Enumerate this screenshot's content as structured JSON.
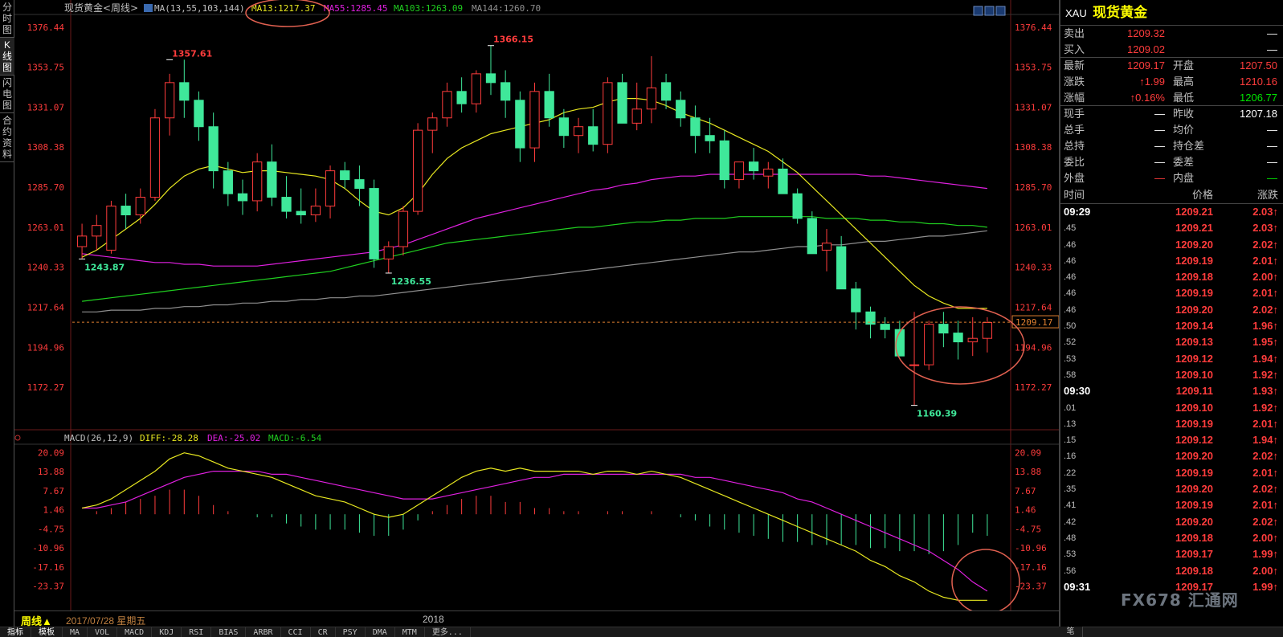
{
  "left_tabs": [
    {
      "label": [
        "分",
        "时",
        "图"
      ],
      "active": false
    },
    {
      "label": [
        "K",
        "线",
        "图"
      ],
      "active": true
    },
    {
      "label": [
        "闪",
        "电",
        "图"
      ],
      "active": false
    },
    {
      "label": [
        "合",
        "约",
        "资",
        "料"
      ],
      "active": false
    }
  ],
  "header": {
    "instrument": "现货黄金<周线>",
    "ma_params": "MA(13,55,103,144)",
    "ma13": "MA13:1217.37",
    "ma55": "MA55:1285.45",
    "ma103": "MA103:1263.09",
    "ma144": "MA144:1260.70"
  },
  "colors": {
    "up": "#ff3c3c",
    "down": "#3fe89a",
    "ma13": "#e8e820",
    "ma55": "#e020e0",
    "ma103": "#20d020",
    "ma144": "#909090",
    "axis_red": "#ff3c3c",
    "circle": "#e06050"
  },
  "price_axis": {
    "labels": [
      "1376.44",
      "1353.75",
      "1331.07",
      "1308.38",
      "1285.70",
      "1263.01",
      "1240.33",
      "1217.64",
      "1194.96",
      "1172.27"
    ],
    "current": "1209.17",
    "current_value": 1209.17
  },
  "annotations": {
    "high1": "1357.61",
    "high2": "1366.15",
    "low1": "1243.87",
    "low2": "1236.55",
    "low3": "1160.39"
  },
  "macd_header": {
    "params": "MACD(26,12,9)",
    "diff": "DIFF:-28.28",
    "dea": "DEA:-25.02",
    "macd": "MACD:-6.54"
  },
  "macd_axis": {
    "labels": [
      "20.09",
      "13.88",
      "7.67",
      "1.46",
      "-4.75",
      "-10.96",
      "-17.16",
      "-23.37"
    ]
  },
  "bottom": {
    "period": "周线▲",
    "date": "2017/07/28 星期五",
    "year_label": "2018"
  },
  "tool_tabs": [
    "指标",
    "模板",
    "MA",
    "VOL",
    "MACD",
    "KDJ",
    "RSI",
    "BIAS",
    "ARBR",
    "CCI",
    "CR",
    "PSY",
    "DMA",
    "MTM",
    "更多..."
  ],
  "right_panel": {
    "code": "XAU",
    "name": "现货黄金",
    "rows": [
      {
        "l1": "卖出",
        "v1": "1209.32",
        "c1": "red",
        "l2": "",
        "v2": "—",
        "c2": "wht"
      },
      {
        "l1": "买入",
        "v1": "1209.02",
        "c1": "red",
        "l2": "",
        "v2": "—",
        "c2": "wht"
      },
      {
        "l1": "最新",
        "v1": "1209.17",
        "c1": "red",
        "l2": "开盘",
        "v2": "1207.50",
        "c2": "red"
      },
      {
        "l1": "涨跌",
        "v1": "↑1.99",
        "c1": "red",
        "l2": "最高",
        "v2": "1210.16",
        "c2": "red"
      },
      {
        "l1": "涨幅",
        "v1": "↑0.16%",
        "c1": "red",
        "l2": "最低",
        "v2": "1206.77",
        "c2": "grn"
      },
      {
        "l1": "现手",
        "v1": "—",
        "c1": "wht",
        "l2": "昨收",
        "v2": "1207.18",
        "c2": "wht"
      },
      {
        "l1": "总手",
        "v1": "—",
        "c1": "wht",
        "l2": "均价",
        "v2": "—",
        "c2": "wht"
      },
      {
        "l1": "总持",
        "v1": "—",
        "c1": "wht",
        "l2": "持仓差",
        "v2": "—",
        "c2": "wht"
      },
      {
        "l1": "委比",
        "v1": "—",
        "c1": "wht",
        "l2": "委差",
        "v2": "—",
        "c2": "wht"
      },
      {
        "l1": "外盘",
        "v1": "—",
        "c1": "red",
        "l2": "内盘",
        "v2": "—",
        "c2": "grn"
      }
    ],
    "ticks_header": [
      "时间",
      "价格",
      "涨跌"
    ],
    "ticks": [
      {
        "t": "09:29",
        "p": "1209.21",
        "c": "2.03↑"
      },
      {
        "t": ".45",
        "p": "1209.21",
        "c": "2.03↑"
      },
      {
        "t": ".46",
        "p": "1209.20",
        "c": "2.02↑"
      },
      {
        "t": ".46",
        "p": "1209.19",
        "c": "2.01↑"
      },
      {
        "t": ".46",
        "p": "1209.18",
        "c": "2.00↑"
      },
      {
        "t": ".46",
        "p": "1209.19",
        "c": "2.01↑"
      },
      {
        "t": ".46",
        "p": "1209.20",
        "c": "2.02↑"
      },
      {
        "t": ".50",
        "p": "1209.14",
        "c": "1.96↑"
      },
      {
        "t": ".52",
        "p": "1209.13",
        "c": "1.95↑"
      },
      {
        "t": ".53",
        "p": "1209.12",
        "c": "1.94↑"
      },
      {
        "t": ".58",
        "p": "1209.10",
        "c": "1.92↑"
      },
      {
        "t": "09:30",
        "p": "1209.11",
        "c": "1.93↑"
      },
      {
        "t": ".01",
        "p": "1209.10",
        "c": "1.92↑"
      },
      {
        "t": ".13",
        "p": "1209.19",
        "c": "2.01↑"
      },
      {
        "t": ".15",
        "p": "1209.12",
        "c": "1.94↑"
      },
      {
        "t": ".16",
        "p": "1209.20",
        "c": "2.02↑"
      },
      {
        "t": ".22",
        "p": "1209.19",
        "c": "2.01↑"
      },
      {
        "t": ".35",
        "p": "1209.20",
        "c": "2.02↑"
      },
      {
        "t": ".41",
        "p": "1209.19",
        "c": "2.01↑"
      },
      {
        "t": ".42",
        "p": "1209.20",
        "c": "2.02↑"
      },
      {
        "t": ".48",
        "p": "1209.18",
        "c": "2.00↑"
      },
      {
        "t": ".53",
        "p": "1209.17",
        "c": "1.99↑"
      },
      {
        "t": ".56",
        "p": "1209.18",
        "c": "2.00↑"
      },
      {
        "t": "09:31",
        "p": "1209.17",
        "c": "1.99↑"
      }
    ],
    "stroke_label": "笔"
  },
  "chart_data": {
    "type": "candlestick",
    "price_range": [
      1155,
      1380
    ],
    "macd_range": [
      -30,
      22
    ],
    "candles": [
      [
        1252,
        1265,
        1245,
        1258
      ],
      [
        1258,
        1270,
        1250,
        1264
      ],
      [
        1250,
        1278,
        1248,
        1275
      ],
      [
        1275,
        1282,
        1262,
        1270
      ],
      [
        1270,
        1285,
        1265,
        1280
      ],
      [
        1280,
        1330,
        1278,
        1325
      ],
      [
        1325,
        1350,
        1315,
        1345
      ],
      [
        1345,
        1358,
        1325,
        1335
      ],
      [
        1335,
        1340,
        1312,
        1320
      ],
      [
        1320,
        1328,
        1285,
        1295
      ],
      [
        1295,
        1300,
        1275,
        1282
      ],
      [
        1282,
        1290,
        1270,
        1278
      ],
      [
        1278,
        1305,
        1272,
        1300
      ],
      [
        1300,
        1310,
        1275,
        1280
      ],
      [
        1280,
        1292,
        1268,
        1272
      ],
      [
        1272,
        1285,
        1265,
        1270
      ],
      [
        1270,
        1285,
        1266,
        1275
      ],
      [
        1275,
        1298,
        1268,
        1295
      ],
      [
        1295,
        1300,
        1285,
        1290
      ],
      [
        1290,
        1298,
        1275,
        1285
      ],
      [
        1285,
        1290,
        1240,
        1245
      ],
      [
        1245,
        1255,
        1237,
        1252
      ],
      [
        1252,
        1275,
        1247,
        1272
      ],
      [
        1272,
        1322,
        1270,
        1318
      ],
      [
        1318,
        1328,
        1305,
        1325
      ],
      [
        1325,
        1345,
        1320,
        1340
      ],
      [
        1340,
        1348,
        1328,
        1333
      ],
      [
        1333,
        1352,
        1328,
        1350
      ],
      [
        1350,
        1366,
        1338,
        1345
      ],
      [
        1345,
        1352,
        1325,
        1335
      ],
      [
        1335,
        1340,
        1300,
        1308
      ],
      [
        1308,
        1345,
        1300,
        1340
      ],
      [
        1340,
        1350,
        1320,
        1325
      ],
      [
        1325,
        1330,
        1308,
        1315
      ],
      [
        1315,
        1325,
        1305,
        1320
      ],
      [
        1320,
        1330,
        1306,
        1310
      ],
      [
        1310,
        1348,
        1305,
        1345
      ],
      [
        1345,
        1350,
        1328,
        1322
      ],
      [
        1322,
        1345,
        1318,
        1330
      ],
      [
        1330,
        1360,
        1322,
        1342
      ],
      [
        1345,
        1350,
        1330,
        1335
      ],
      [
        1335,
        1340,
        1320,
        1325
      ],
      [
        1325,
        1332,
        1305,
        1315
      ],
      [
        1315,
        1325,
        1305,
        1312
      ],
      [
        1312,
        1318,
        1285,
        1290
      ],
      [
        1290,
        1300,
        1285,
        1300
      ],
      [
        1300,
        1308,
        1290,
        1295
      ],
      [
        1292,
        1300,
        1285,
        1296
      ],
      [
        1296,
        1302,
        1283,
        1282
      ],
      [
        1282,
        1285,
        1265,
        1268
      ],
      [
        1268,
        1272,
        1248,
        1248
      ],
      [
        1250,
        1262,
        1238,
        1254
      ],
      [
        1252,
        1258,
        1228,
        1228
      ],
      [
        1228,
        1232,
        1205,
        1215
      ],
      [
        1215,
        1218,
        1200,
        1208
      ],
      [
        1208,
        1212,
        1200,
        1205
      ],
      [
        1205,
        1210,
        1190,
        1190
      ],
      [
        1185,
        1215,
        1162,
        1185
      ],
      [
        1185,
        1210,
        1182,
        1208
      ],
      [
        1208,
        1215,
        1195,
        1203
      ],
      [
        1203,
        1210,
        1188,
        1198
      ],
      [
        1198,
        1212,
        1190,
        1200
      ],
      [
        1200,
        1212,
        1192,
        1209
      ]
    ],
    "ma13": [
      1246,
      1250,
      1256,
      1262,
      1268,
      1276,
      1285,
      1292,
      1296,
      1298,
      1296,
      1294,
      1295,
      1295,
      1294,
      1293,
      1292,
      1290,
      1285,
      1278,
      1272,
      1270,
      1274,
      1282,
      1293,
      1302,
      1308,
      1312,
      1316,
      1318,
      1320,
      1322,
      1324,
      1328,
      1330,
      1331,
      1334,
      1336,
      1336,
      1335,
      1332,
      1328,
      1325,
      1322,
      1318,
      1314,
      1310,
      1306,
      1300,
      1294,
      1286,
      1278,
      1270,
      1262,
      1254,
      1246,
      1238,
      1230,
      1224,
      1220,
      1217,
      1217,
      1217
    ],
    "ma55": [
      1248,
      1247,
      1246,
      1245,
      1244,
      1243,
      1243,
      1242,
      1242,
      1241,
      1241,
      1241,
      1241,
      1242,
      1243,
      1244,
      1245,
      1246,
      1247,
      1248,
      1249,
      1251,
      1253,
      1256,
      1259,
      1262,
      1265,
      1268,
      1270,
      1272,
      1274,
      1276,
      1278,
      1280,
      1282,
      1284,
      1285,
      1287,
      1288,
      1290,
      1291,
      1292,
      1292,
      1293,
      1293,
      1293,
      1293,
      1293,
      1293,
      1293,
      1293,
      1293,
      1293,
      1293,
      1292,
      1292,
      1291,
      1290,
      1289,
      1288,
      1287,
      1286,
      1285
    ],
    "ma103": [
      1221,
      1222,
      1223,
      1224,
      1225,
      1226,
      1227,
      1228,
      1229,
      1230,
      1231,
      1232,
      1233,
      1234,
      1235,
      1236,
      1237,
      1238,
      1240,
      1242,
      1244,
      1246,
      1248,
      1250,
      1252,
      1254,
      1255,
      1256,
      1257,
      1258,
      1259,
      1260,
      1261,
      1262,
      1263,
      1263,
      1264,
      1265,
      1266,
      1266,
      1267,
      1267,
      1268,
      1268,
      1268,
      1269,
      1269,
      1269,
      1269,
      1269,
      1269,
      1268,
      1268,
      1268,
      1267,
      1267,
      1266,
      1266,
      1265,
      1265,
      1264,
      1264,
      1263
    ],
    "ma144": [
      1215,
      1215,
      1216,
      1216,
      1216,
      1217,
      1217,
      1218,
      1218,
      1219,
      1219,
      1220,
      1220,
      1221,
      1221,
      1222,
      1222,
      1223,
      1223,
      1224,
      1224,
      1225,
      1226,
      1227,
      1228,
      1229,
      1230,
      1231,
      1232,
      1233,
      1234,
      1235,
      1236,
      1237,
      1238,
      1239,
      1240,
      1241,
      1242,
      1243,
      1244,
      1245,
      1246,
      1247,
      1248,
      1249,
      1249,
      1250,
      1251,
      1252,
      1252,
      1253,
      1253,
      1254,
      1255,
      1255,
      1256,
      1257,
      1258,
      1258,
      1259,
      1260,
      1261
    ],
    "diff": [
      2,
      3,
      5,
      8,
      11,
      14,
      18,
      20,
      19,
      17,
      15,
      14,
      13,
      12,
      10,
      8,
      6,
      5,
      4,
      2,
      0,
      -1,
      0,
      3,
      6,
      9,
      12,
      14,
      15,
      14,
      15,
      14,
      14,
      14,
      14,
      13,
      14,
      14,
      13,
      14,
      13,
      12,
      10,
      8,
      6,
      4,
      2,
      0,
      -2,
      -4,
      -6,
      -8,
      -10,
      -12,
      -15,
      -17,
      -20,
      -22,
      -25,
      -27,
      -28,
      -28,
      -28
    ],
    "dea": [
      2,
      2,
      3,
      4,
      6,
      8,
      10,
      12,
      13,
      14,
      14,
      14,
      14,
      13,
      13,
      12,
      11,
      10,
      9,
      8,
      7,
      6,
      5,
      5,
      5,
      6,
      7,
      8,
      9,
      10,
      11,
      12,
      12,
      13,
      13,
      13,
      13,
      13,
      13,
      13,
      13,
      13,
      12,
      12,
      11,
      10,
      9,
      8,
      7,
      5,
      4,
      2,
      0,
      -2,
      -4,
      -6,
      -8,
      -10,
      -12,
      -15,
      -18,
      -22,
      -25
    ],
    "macd": [
      0,
      1,
      2,
      4,
      5,
      6,
      8,
      8,
      6,
      3,
      1,
      0,
      -1,
      -1,
      -3,
      -4,
      -5,
      -5,
      -5,
      -6,
      -7,
      -7,
      -5,
      -2,
      1,
      3,
      5,
      6,
      6,
      4,
      4,
      2,
      2,
      1,
      1,
      0,
      1,
      1,
      0,
      1,
      0,
      -1,
      -2,
      -4,
      -5,
      -6,
      -7,
      -8,
      -9,
      -9,
      -10,
      -10,
      -10,
      -10,
      -11,
      -11,
      -12,
      -12,
      -13,
      -12,
      -10,
      -6,
      -7
    ]
  }
}
